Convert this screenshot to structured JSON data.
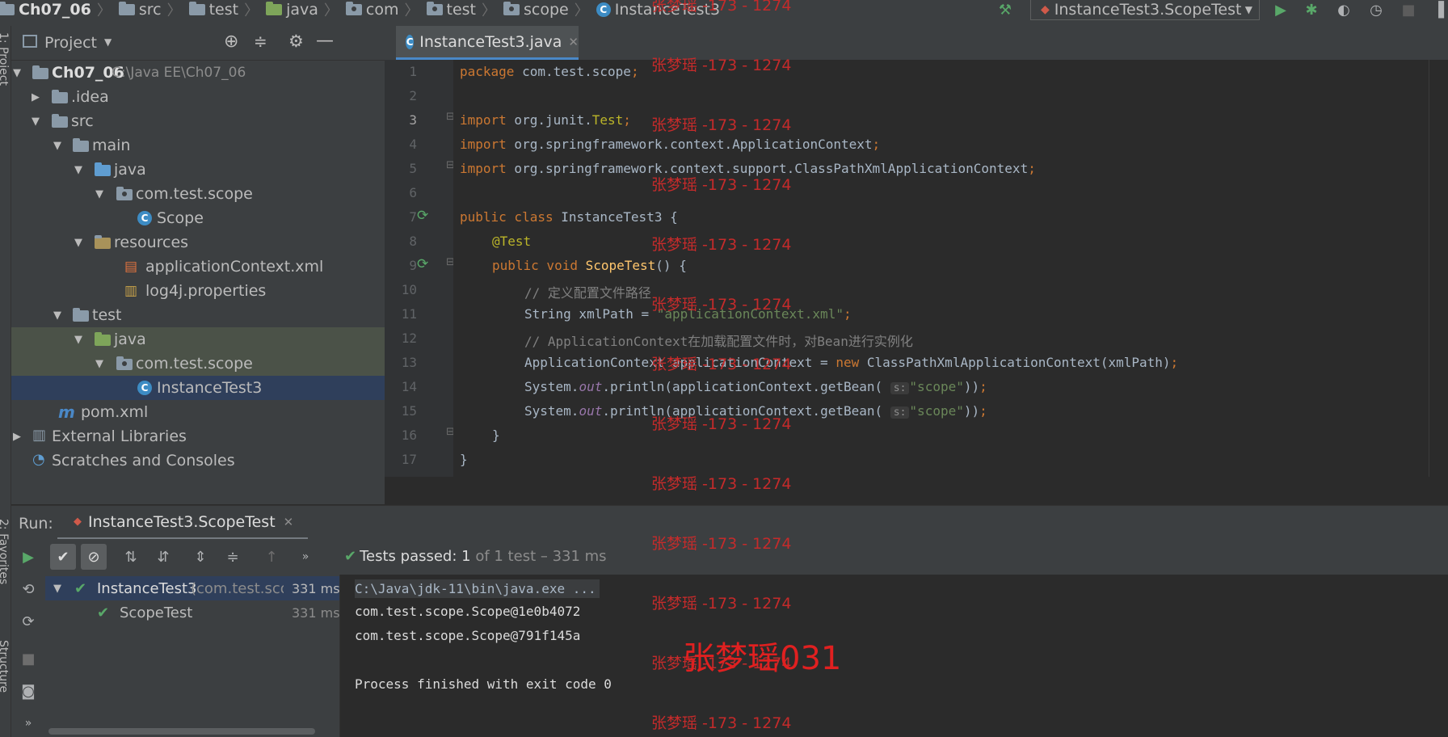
{
  "breadcrumb": {
    "items": [
      "Ch07_06",
      "src",
      "test",
      "java",
      "com",
      "test",
      "scope",
      "InstanceTest3"
    ]
  },
  "run_config": {
    "label": "InstanceTest3.ScopeTest"
  },
  "project_panel": {
    "title": "Project",
    "tree": [
      {
        "label": "Ch07_06",
        "extra": "C:\\Java EE\\Ch07_06"
      },
      {
        "label": ".idea"
      },
      {
        "label": "src"
      },
      {
        "label": "main"
      },
      {
        "label": "java"
      },
      {
        "label": "com.test.scope"
      },
      {
        "label": "Scope"
      },
      {
        "label": "resources"
      },
      {
        "label": "applicationContext.xml"
      },
      {
        "label": "log4j.properties"
      },
      {
        "label": "test"
      },
      {
        "label": "java"
      },
      {
        "label": "com.test.scope"
      },
      {
        "label": "InstanceTest3"
      },
      {
        "label": "pom.xml"
      },
      {
        "label": "External Libraries"
      },
      {
        "label": "Scratches and Consoles"
      }
    ]
  },
  "left_stripe": {
    "project": "1: Project",
    "favorites": "2: Favorites",
    "structure": "Structure"
  },
  "editor": {
    "tab_label": "InstanceTest3.java",
    "line_numbers": [
      "1",
      "2",
      "3",
      "4",
      "5",
      "6",
      "7",
      "8",
      "9",
      "10",
      "11",
      "12",
      "13",
      "14",
      "15",
      "16",
      "17"
    ],
    "code": {
      "l1_kw": "package",
      "l1_rest": " com.test.scope",
      "l1_semi": ";",
      "l3_kw": "import",
      "l3_pkg": " org.junit.",
      "l3_cls": "Test",
      "l3_semi": ";",
      "l4_kw": "import",
      "l4_rest": " org.springframework.context.ApplicationContext",
      "l4_semi": ";",
      "l5_kw": "import",
      "l5_rest": " org.springframework.context.support.ClassPathXmlApplicationContext",
      "l5_semi": ";",
      "l7_kw": "public class",
      "l7_rest": " InstanceTest3 {",
      "l8_ann": "@Test",
      "l9_kw": "public void",
      "l9_fn": " ScopeTest",
      "l9_rest": "() {",
      "l10_cmt": "// 定义配置文件路径",
      "l11_pre": "String xmlPath = ",
      "l11_str": "\"applicationContext.xml\"",
      "l11_semi": ";",
      "l12_cmt": "// ApplicationContext在加载配置文件时，对Bean进行实例化",
      "l13_pre": "ApplicationContext applicationContext = ",
      "l13_kw": "new",
      "l13_rest": " ClassPathXmlApplicationContext(xmlPath)",
      "l13_semi": ";",
      "l14_pre": "System.",
      "l14_fld": "out",
      "l14_mid": ".println(applicationContext.getBean(",
      "l14_hint": "s:",
      "l14_str": "\"scope\"",
      "l14_end": "))",
      "l14_semi": ";",
      "l15_pre": "System.",
      "l15_fld": "out",
      "l15_mid": ".println(applicationContext.getBean(",
      "l15_hint": "s:",
      "l15_str": "\"scope\"",
      "l15_end": "))",
      "l15_semi": ";",
      "l16": "}",
      "l17": "}"
    }
  },
  "run_panel": {
    "label": "Run:",
    "tab_label": "InstanceTest3.ScopeTest",
    "status_prefix": "Tests passed: ",
    "status_count": "1",
    "status_suffix": " of 1 test – 331 ms",
    "tests": [
      {
        "name": "InstanceTest3",
        "detail": " (com.test.sco",
        "time": "331 ms"
      },
      {
        "name": "ScopeTest",
        "detail": "",
        "time": "331 ms"
      }
    ],
    "console": [
      "C:\\Java\\jdk-11\\bin\\java.exe ...",
      "com.test.scope.Scope@1e0b4072",
      "com.test.scope.Scope@791f145a",
      "",
      "Process finished with exit code 0"
    ]
  },
  "watermark": {
    "text": "张梦瑶 -173 - 1274",
    "big": "张梦瑶031"
  },
  "colors": {
    "keyword": "#cc7832",
    "string": "#6a8759",
    "annotation": "#bbb529",
    "method": "#ffc66d",
    "pass": "#59a869",
    "watermark": "#c42b2b"
  }
}
